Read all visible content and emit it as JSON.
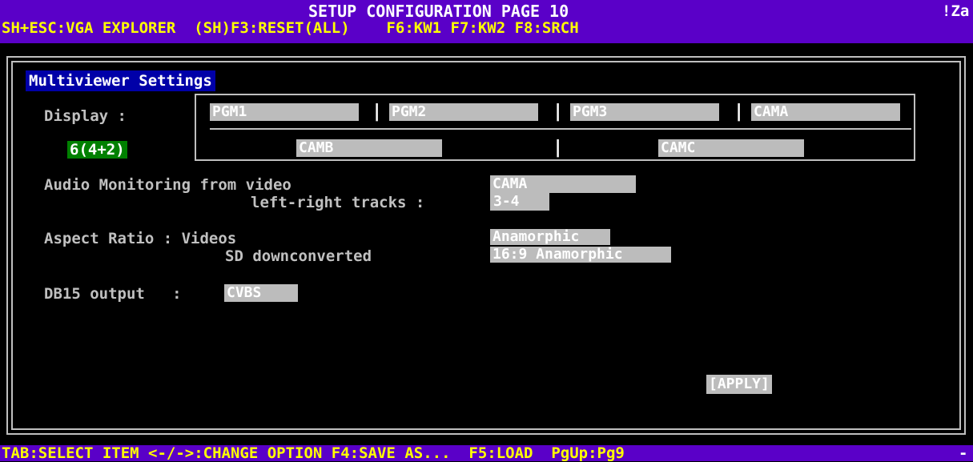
{
  "header": {
    "title": "SETUP CONFIGURATION PAGE 10",
    "corner": "!Za",
    "shortcuts": "SH+ESC:VGA EXPLORER  (SH)F3:RESET(ALL)    F6:KW1 F7:KW2 F8:SRCH"
  },
  "section": {
    "title": "Multiviewer Settings"
  },
  "display": {
    "label": "Display :",
    "mode": "6(4+2)",
    "row1": [
      "PGM1",
      "PGM2",
      "PGM3",
      "CAMA"
    ],
    "row2": [
      "CAMB",
      "CAMC"
    ],
    "separator": "|"
  },
  "audio": {
    "label": "Audio Monitoring from video",
    "source": "CAMA",
    "tracks_label": "left-right tracks :",
    "tracks": "3-4"
  },
  "aspect": {
    "label": "Aspect Ratio : Videos",
    "videos": "Anamorphic",
    "sd_label": "SD downconverted",
    "sd": "16:9 Anamorphic"
  },
  "db15": {
    "label": "DB15 output   :",
    "value": "CVBS"
  },
  "apply": {
    "label": "[APPLY]"
  },
  "footer": {
    "text": "TAB:SELECT ITEM <-/->:CHANGE OPTION F4:SAVE AS...  F5:LOAD  PgUp:Pg9",
    "dash": "-"
  },
  "colors": {
    "bar": "#5a00c8",
    "shortcut_text": "#ffff00",
    "field_bg": "#bcbcbc",
    "section_bg": "#0000a8",
    "mode_bg": "#008000"
  }
}
